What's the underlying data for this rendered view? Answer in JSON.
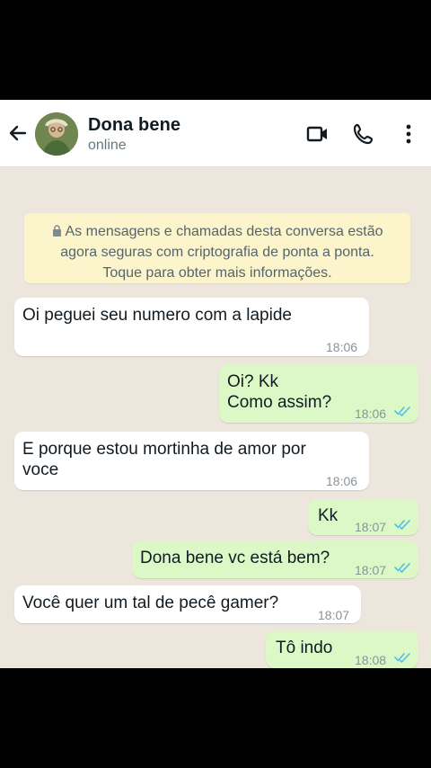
{
  "header": {
    "contact_name": "Dona bene",
    "status": "online"
  },
  "notice": {
    "line1": "As mensagens e chamadas desta conversa estão",
    "line2": "agora seguras com criptografia de ponta a ponta.",
    "line3": "Toque para obter mais informações."
  },
  "messages": [
    {
      "direction": "in",
      "text": "Oi peguei seu numero com a lapide",
      "time": "18:06"
    },
    {
      "direction": "out",
      "line1": "Oi? Kk",
      "line2": "Como assim?",
      "time": "18:06",
      "status": "read"
    },
    {
      "direction": "in",
      "line1": "E porque estou mortinha de amor por",
      "line2": "voce",
      "time": "18:06"
    },
    {
      "direction": "out",
      "text": "Kk",
      "time": "18:07",
      "status": "read"
    },
    {
      "direction": "out",
      "text": "Dona bene vc está bem?",
      "time": "18:07",
      "status": "read"
    },
    {
      "direction": "in",
      "text": "Você quer um tal de pecê gamer?",
      "time": "18:07"
    },
    {
      "direction": "out",
      "text": "Tô indo",
      "time": "18:08",
      "status": "read"
    }
  ],
  "colors": {
    "chat_background": "#ece6dd",
    "incoming_bubble": "#ffffff",
    "outgoing_bubble": "#dcf8c6",
    "notice_background": "#fcf4cb",
    "read_ticks": "#53bdeb"
  },
  "icons": [
    "back-arrow-icon",
    "video-call-icon",
    "phone-icon",
    "more-options-icon",
    "lock-icon",
    "double-check-icon"
  ]
}
